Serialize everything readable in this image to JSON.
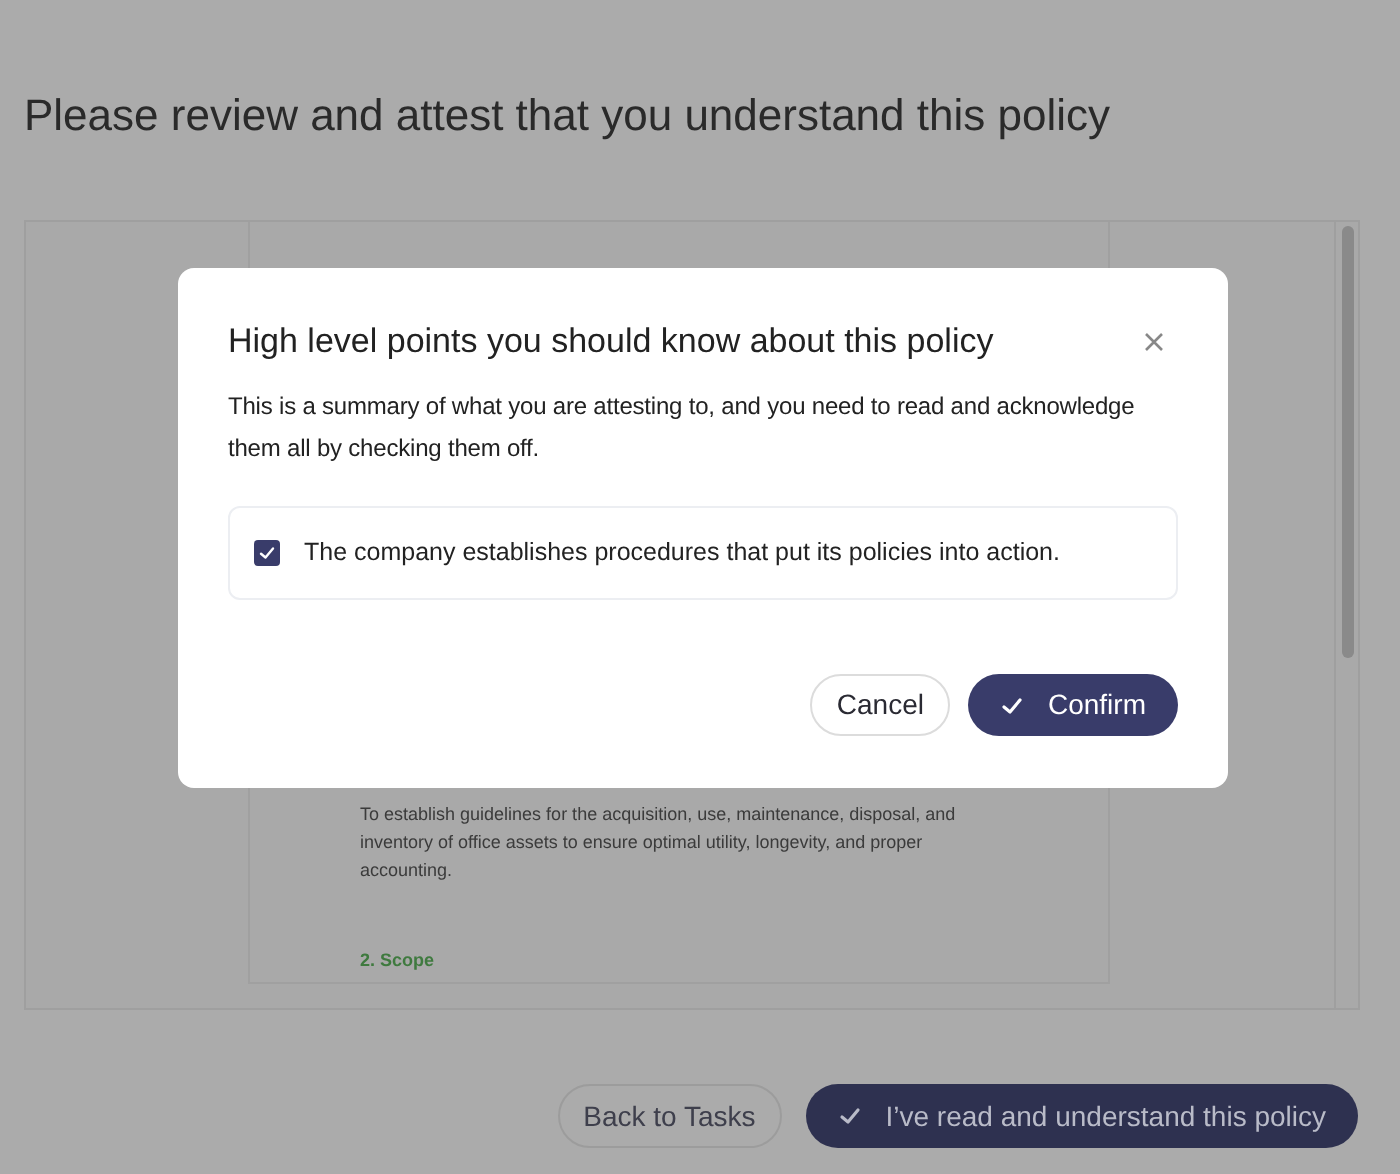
{
  "page": {
    "title": "Please review and attest that you understand this policy"
  },
  "document": {
    "paragraph": "To establish guidelines for the acquisition, use, maintenance, disposal, and inventory of office assets to ensure optimal utility, longevity, and proper accounting.",
    "section_heading": "2. Scope"
  },
  "footer_buttons": [
    {
      "label": "Back to Tasks",
      "kind": "secondary"
    },
    {
      "label": "I’ve read and understand this policy",
      "kind": "primary"
    }
  ],
  "dialog": {
    "title": "High level points you should know about this policy",
    "description": "This is a summary of what you are attesting to, and you need to read and acknowledge them all by checking them off.",
    "items": [
      {
        "text": "The company establishes procedures that put its policies into action.",
        "checked": true
      }
    ],
    "buttons": [
      {
        "label": "Cancel",
        "kind": "secondary"
      },
      {
        "label": "Confirm",
        "kind": "primary"
      }
    ]
  }
}
